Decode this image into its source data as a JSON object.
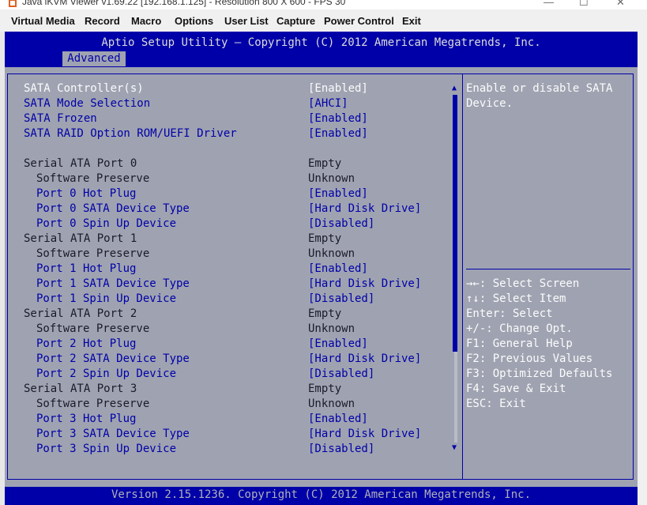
{
  "window": {
    "title": "Java iKVM Viewer v1.69.22 [192.168.1.125] - Resolution 800 X 600 - FPS 30",
    "controls": [
      "—",
      "☐",
      "✕"
    ]
  },
  "menu": {
    "items": [
      "Virtual Media",
      "Record",
      "Macro",
      "Options",
      "User List",
      "Capture",
      "Power Control",
      "Exit"
    ]
  },
  "bios": {
    "title": "Aptio Setup Utility – Copyright (C) 2012 American Megatrends, Inc.",
    "tab": "Advanced",
    "footer": "Version 2.15.1236. Copyright (C) 2012 American Megatrends, Inc.",
    "help_text": "Enable or disable SATA Device.",
    "key_help": [
      "→←: Select Screen",
      "↑↓: Select Item",
      "Enter: Select",
      "+/-: Change Opt.",
      "F1: General Help",
      "F2: Previous Values",
      "F3: Optimized Defaults",
      "F4: Save & Exit",
      "ESC: Exit"
    ],
    "settings": [
      {
        "label": "SATA Controller(s)",
        "value": "[Enabled]",
        "selected": true
      },
      {
        "label": "SATA Mode Selection",
        "value": "[AHCI]"
      },
      {
        "label": "SATA Frozen",
        "value": "[Enabled]"
      },
      {
        "label": "SATA RAID Option ROM/UEFI Driver",
        "value": "[Enabled]"
      },
      {
        "label": "Serial ATA Port 0",
        "value": "Empty",
        "static": true,
        "gap": true
      },
      {
        "label": "Software Preserve",
        "value": "Unknown",
        "static": true,
        "indent": true
      },
      {
        "label": "Port 0 Hot Plug",
        "value": "[Enabled]",
        "indent": true
      },
      {
        "label": "Port 0 SATA Device Type",
        "value": "[Hard Disk Drive]",
        "indent": true
      },
      {
        "label": "Port 0 Spin Up Device",
        "value": "[Disabled]",
        "indent": true
      },
      {
        "label": "Serial ATA Port 1",
        "value": "Empty",
        "static": true
      },
      {
        "label": "Software Preserve",
        "value": "Unknown",
        "static": true,
        "indent": true
      },
      {
        "label": "Port 1 Hot Plug",
        "value": "[Enabled]",
        "indent": true
      },
      {
        "label": "Port 1 SATA Device Type",
        "value": "[Hard Disk Drive]",
        "indent": true
      },
      {
        "label": "Port 1 Spin Up Device",
        "value": "[Disabled]",
        "indent": true
      },
      {
        "label": "Serial ATA Port 2",
        "value": "Empty",
        "static": true
      },
      {
        "label": "Software Preserve",
        "value": "Unknown",
        "static": true,
        "indent": true
      },
      {
        "label": "Port 2 Hot Plug",
        "value": "[Enabled]",
        "indent": true
      },
      {
        "label": "Port 2 SATA Device Type",
        "value": "[Hard Disk Drive]",
        "indent": true
      },
      {
        "label": "Port 2 Spin Up Device",
        "value": "[Disabled]",
        "indent": true
      },
      {
        "label": "Serial ATA Port 3",
        "value": "Empty",
        "static": true
      },
      {
        "label": "Software Preserve",
        "value": "Unknown",
        "static": true,
        "indent": true
      },
      {
        "label": "Port 3 Hot Plug",
        "value": "[Enabled]",
        "indent": true
      },
      {
        "label": "Port 3 SATA Device Type",
        "value": "[Hard Disk Drive]",
        "indent": true
      },
      {
        "label": "Port 3 Spin Up Device",
        "value": "[Disabled]",
        "indent": true
      }
    ],
    "scroll": {
      "up_arrow": "▲",
      "down_arrow": "▼"
    }
  },
  "colors": {
    "bios_blue": "#0000a8",
    "bios_gray": "#9fa3b1",
    "highlight_text": "#fcfcfc"
  }
}
